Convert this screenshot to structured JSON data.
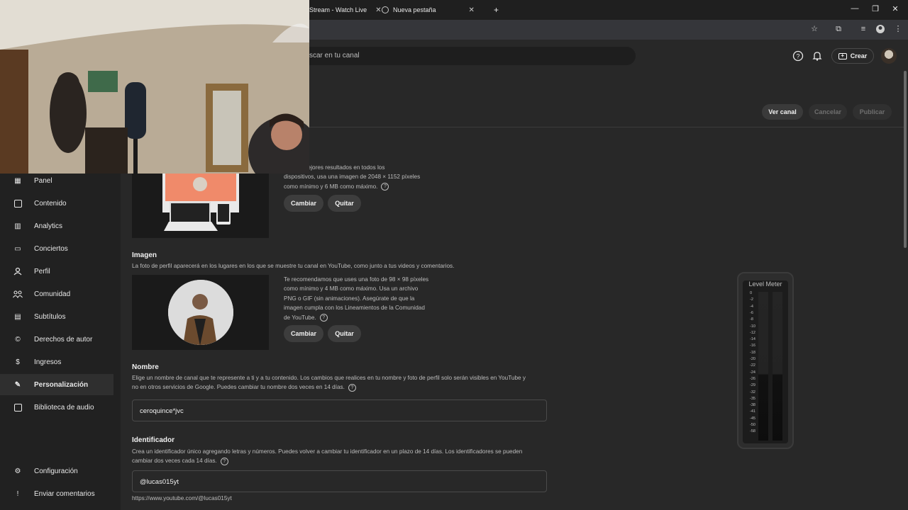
{
  "browser": {
    "tabs": [
      {
        "label": "Stream - Watch Live"
      },
      {
        "label": "Nueva pestaña"
      }
    ],
    "new_tab": "+"
  },
  "header": {
    "search_placeholder": "scar en tu canal",
    "create_label": "Crear"
  },
  "actions": {
    "ver_canal": "Ver canal",
    "cancelar": "Cancelar",
    "publicar": "Publicar"
  },
  "sidebar": {
    "items": [
      {
        "label": "Panel",
        "icon": "grid-icon"
      },
      {
        "label": "Contenido",
        "icon": "video-icon"
      },
      {
        "label": "Analytics",
        "icon": "chart-icon"
      },
      {
        "label": "Conciertos",
        "icon": "ticket-icon"
      },
      {
        "label": "Perfil",
        "icon": "person-icon"
      },
      {
        "label": "Comunidad",
        "icon": "community-icon"
      },
      {
        "label": "Subtítulos",
        "icon": "subtitles-icon"
      },
      {
        "label": "Derechos de autor",
        "icon": "copyright-icon"
      },
      {
        "label": "Ingresos",
        "icon": "dollar-icon"
      },
      {
        "label": "Personalización",
        "icon": "wand-icon",
        "active": true
      },
      {
        "label": "Biblioteca de audio",
        "icon": "audio-library-icon"
      }
    ],
    "bottom": [
      {
        "label": "Configuración",
        "icon": "gear-icon"
      },
      {
        "label": "Enviar comentarios",
        "icon": "feedback-icon"
      }
    ]
  },
  "banner": {
    "desc_line1": "ner los mejores resultados en todos los",
    "desc_line2": "dispositivos, usa una imagen de 2048 × 1152 píxeles",
    "desc_line3": "como mínimo y 6 MB como máximo.",
    "change": "Cambiar",
    "remove": "Quitar"
  },
  "image": {
    "title": "Imagen",
    "subtitle": "La foto de perfil aparecerá en los lugares en los que se muestre tu canal en YouTube, como junto a tus videos y comentarios.",
    "desc_lines": [
      "Te recomendamos que uses una foto de 98 × 98 píxeles",
      "como mínimo y 4 MB como máximo. Usa un archivo",
      "PNG o GIF (sin animaciones). Asegúrate de que la",
      "imagen cumpla con los Lineamientos de la Comunidad",
      "de YouTube."
    ],
    "change": "Cambiar",
    "remove": "Quitar"
  },
  "name": {
    "title": "Nombre",
    "desc_line1": "Elige un nombre de canal que te represente a ti y a tu contenido. Los cambios que realices en tu nombre y foto de perfil solo serán visibles en YouTube y",
    "desc_line2": "no en otros servicios de Google. Puedes cambiar tu nombre dos veces en 14 días.",
    "value": "ceroquince*jvc"
  },
  "handle": {
    "title": "Identificador",
    "desc_line1": "Crea un identificador único agregando letras y números. Puedes volver a cambiar tu identificador en un plazo de 14 días. Los identificadores se pueden",
    "desc_line2": "cambiar dos veces cada 14 días.",
    "value": "@lucas015yt",
    "url": "https://www.youtube.com/@lucas015yt"
  },
  "meter": {
    "title": "Level Meter",
    "scale": [
      "0",
      "-2",
      "-4",
      "-6",
      "-8",
      "-10",
      "-12",
      "-14",
      "-16",
      "-18",
      "-20",
      "-22",
      "-24",
      "-26",
      "-29",
      "-32",
      "-35",
      "-38",
      "-41",
      "-45",
      "-50",
      "-58"
    ]
  }
}
